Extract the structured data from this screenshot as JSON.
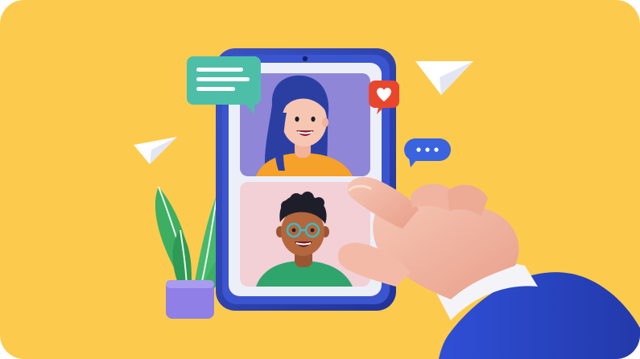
{
  "scene": {
    "background_color": "#FCCB4E",
    "tablet": {
      "frame_color": "#2A3EA6",
      "screen_color": "#EDEFF8"
    },
    "video_tiles": [
      {
        "person": "woman",
        "background_color": "#8F86D8",
        "shirt_color": "#F6A12A",
        "hair_color": "#2B3FA3"
      },
      {
        "person": "man",
        "background_color": "#F3CFD6",
        "shirt_color": "#2FA56C",
        "hair_color": "#1E1E2A"
      }
    ],
    "icons": [
      "chat-bubble-icon",
      "heart-icon",
      "typing-bubble-icon",
      "paper-plane-icon",
      "paper-plane-icon"
    ],
    "accent_colors": {
      "chat_bubble": "#4DBFA9",
      "heart_badge": "#E8472E",
      "typing_bubble": "#3A63E0",
      "plant": "#3DAE62",
      "pot": "#8F7FE6",
      "sleeve": "#2C49C9"
    }
  }
}
